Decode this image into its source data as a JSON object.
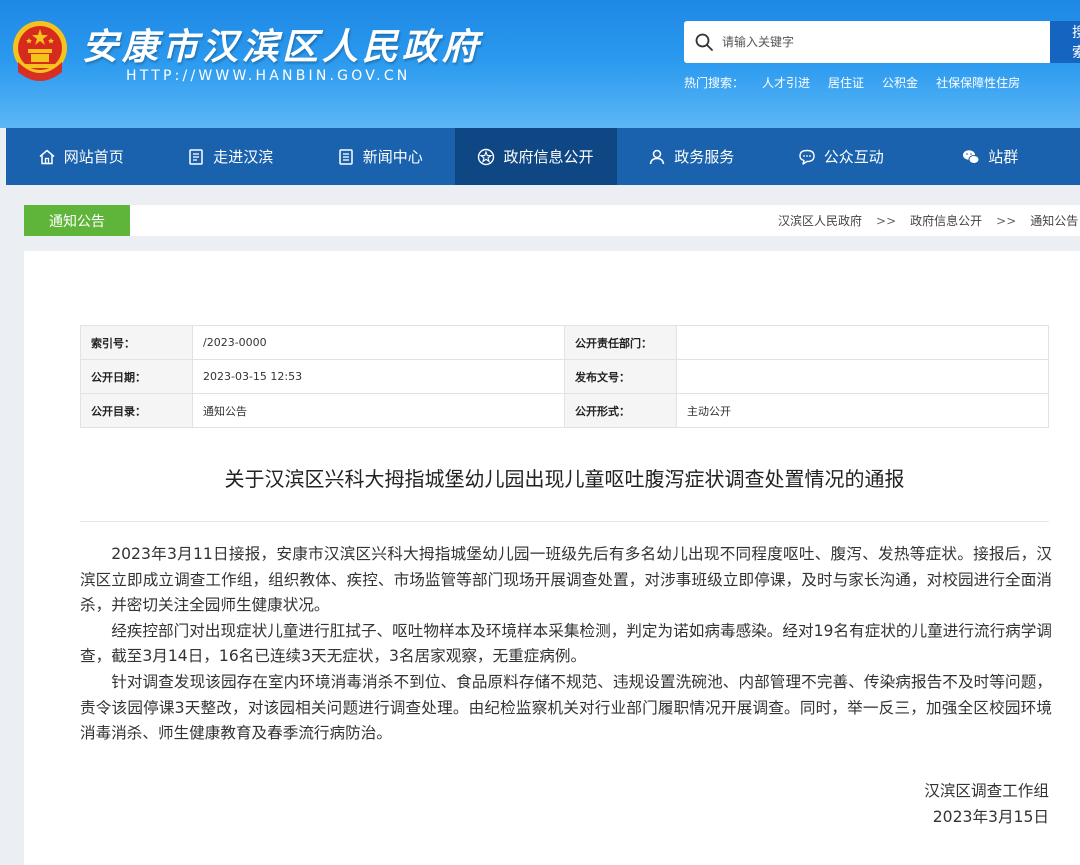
{
  "header": {
    "site_title": "安康市汉滨区人民政府",
    "site_url": "HTTP://WWW.HANBIN.GOV.CN",
    "search": {
      "placeholder": "请输入关键字",
      "button_label": "搜索"
    },
    "hot_search": {
      "label": "热门搜索：",
      "items": [
        "人才引进",
        "居住证",
        "公积金",
        "社保保障性住房"
      ]
    }
  },
  "nav": {
    "items": [
      {
        "label": "网站首页",
        "icon": "home-icon"
      },
      {
        "label": "走进汉滨",
        "icon": "document-icon"
      },
      {
        "label": "新闻中心",
        "icon": "news-icon"
      },
      {
        "label": "政府信息公开",
        "icon": "star-icon"
      },
      {
        "label": "政务服务",
        "icon": "user-icon"
      },
      {
        "label": "公众互动",
        "icon": "chat-icon"
      },
      {
        "label": "站群",
        "icon": "wechat-icon"
      }
    ],
    "active_index": 3
  },
  "section": {
    "tab_label": "通知公告",
    "breadcrumb": [
      "汉滨区人民政府",
      "政府信息公开",
      "通知公告"
    ],
    "breadcrumb_sep": ">>"
  },
  "meta": {
    "index_label": "索引号：",
    "index_value": "/2023-0000",
    "dept_label": "公开责任部门：",
    "dept_value": "",
    "date_label": "公开日期：",
    "date_value": "2023-03-15 12:53",
    "docno_label": "发布文号：",
    "docno_value": "",
    "catalog_label": "公开目录：",
    "catalog_value": "通知公告",
    "form_label": "公开形式：",
    "form_value": "主动公开"
  },
  "article": {
    "title": "关于汉滨区兴科大拇指城堡幼儿园出现儿童呕吐腹泻症状调查处置情况的通报",
    "paragraphs": [
      "2023年3月11日接报，安康市汉滨区兴科大拇指城堡幼儿园一班级先后有多名幼儿出现不同程度呕吐、腹泻、发热等症状。接报后，汉滨区立即成立调查工作组，组织教体、疾控、市场监管等部门现场开展调查处置，对涉事班级立即停课，及时与家长沟通，对校园进行全面消杀，并密切关注全园师生健康状况。",
      "经疾控部门对出现症状儿童进行肛拭子、呕吐物样本及环境样本采集检测，判定为诺如病毒感染。经对19名有症状的儿童进行流行病学调查，截至3月14日，16名已连续3天无症状，3名居家观察，无重症病例。",
      "针对调查发现该园存在室内环境消毒消杀不到位、食品原料存储不规范、违规设置洗碗池、内部管理不完善、传染病报告不及时等问题，责令该园停课3天整改，对该园相关问题进行调查处理。由纪检监察机关对行业部门履职情况开展调查。同时，举一反三，加强全区校园环境消毒消杀、师生健康教育及春季流行病防治。"
    ],
    "signature_org": "汉滨区调查工作组",
    "signature_date": "2023年3月15日"
  },
  "colors": {
    "header_blue": "#2d9cf0",
    "nav_blue": "#1a62ad",
    "nav_active": "#0f4684",
    "tab_green": "#5fb53a"
  }
}
